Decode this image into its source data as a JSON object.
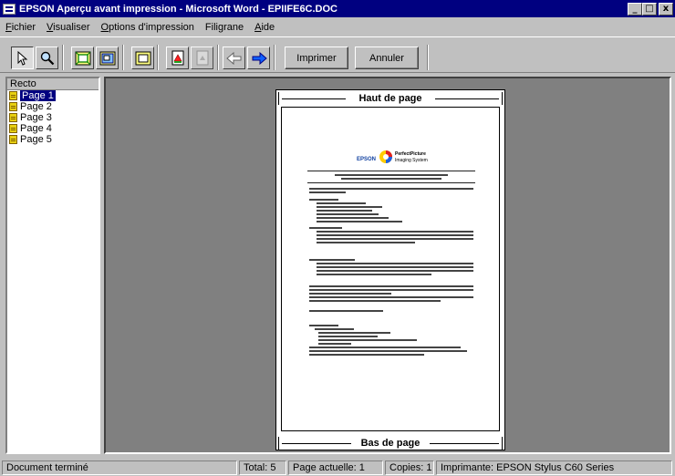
{
  "window": {
    "title": "EPSON Aperçu avant impression - Microsoft Word - EPIIFE6C.DOC",
    "minimize_label": "_",
    "maximize_label": "□",
    "close_label": "x"
  },
  "menu": {
    "items": [
      {
        "accel": "F",
        "rest": "ichier"
      },
      {
        "accel": "V",
        "rest": "isualiser"
      },
      {
        "accel": "O",
        "rest": "ptions d'impression"
      },
      {
        "accel": "",
        "rest": "Filigrane"
      },
      {
        "accel": "A",
        "rest": "ide"
      }
    ]
  },
  "toolbar": {
    "tools": [
      {
        "name": "pointer-tool-icon"
      },
      {
        "name": "zoom-tool-icon"
      },
      {
        "name": "fit-page-icon"
      },
      {
        "name": "full-screen-icon"
      },
      {
        "name": "printable-area-icon"
      },
      {
        "name": "watermark-icon"
      },
      {
        "name": "watermark-settings-icon"
      },
      {
        "name": "previous-page-icon"
      },
      {
        "name": "next-page-icon"
      }
    ],
    "print_label": "Imprimer",
    "cancel_label": "Annuler"
  },
  "sidebar": {
    "header": "Recto",
    "pages": [
      "Page 1",
      "Page 2",
      "Page 3",
      "Page 4",
      "Page 5"
    ],
    "selected_index": 0
  },
  "preview": {
    "header_label": "Haut de page",
    "footer_label": "Bas de page",
    "logo_brand": "EPSON",
    "logo_product_line1": "PerfectPicture",
    "logo_product_line2": "Imaging System"
  },
  "status": {
    "message": "Document terminé",
    "total": "Total: 5",
    "current_page": "Page actuelle: 1",
    "copies": "Copies: 1",
    "printer": "Imprimante: EPSON Stylus C60 Series"
  },
  "colors": {
    "titlebar": "#000080",
    "window_face": "#c0c0c0",
    "preview_background": "#808080",
    "selection": "#000080",
    "page_icon": "#e8d010"
  }
}
